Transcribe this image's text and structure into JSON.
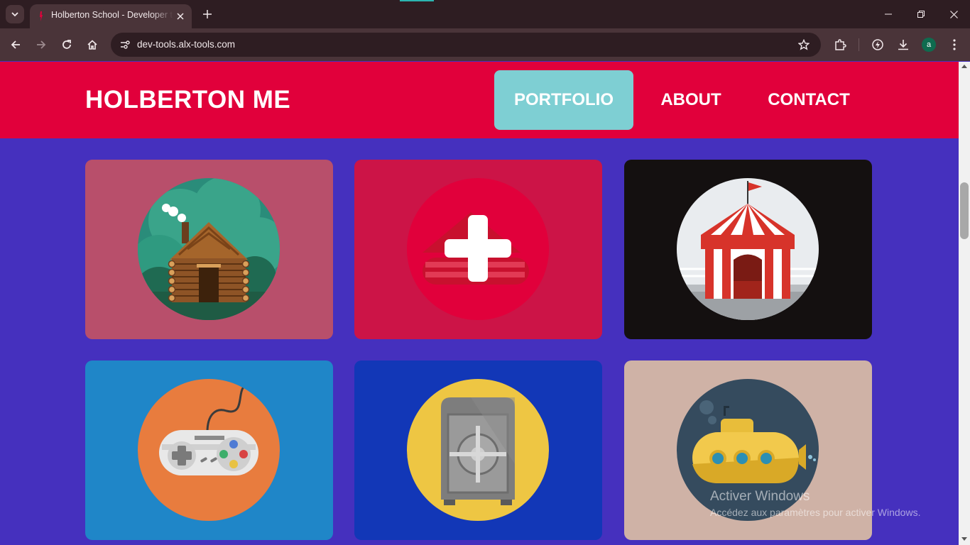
{
  "browser": {
    "tab_title": "Holberton School - Developer tools",
    "url": "dev-tools.alx-tools.com",
    "profile_initial": "a",
    "icons": [
      "tab-search-icon",
      "close-icon",
      "plus-icon",
      "minimize-icon",
      "restore-icon",
      "close-window-icon",
      "back-icon",
      "forward-icon",
      "reload-icon",
      "home-icon",
      "site-info-icon",
      "star-icon",
      "extensions-icon",
      "performance-icon",
      "download-icon",
      "kebab-menu-icon"
    ]
  },
  "site": {
    "brand": "HOLBERTON ME",
    "nav": [
      {
        "label": "PORTFOLIO",
        "active": true
      },
      {
        "label": "ABOUT",
        "active": false
      },
      {
        "label": "CONTACT",
        "active": false
      }
    ],
    "colors": {
      "header": "#e1003b",
      "background": "#4530be",
      "active_nav": "#7ecfd3"
    }
  },
  "portfolio": [
    {
      "name": "log-cabin",
      "bg": "#b84f6b",
      "circle": "#2a8c7a"
    },
    {
      "name": "red-plus",
      "bg": "#cc1447",
      "circle": "#e1003b"
    },
    {
      "name": "circus-tent",
      "bg": "#141010",
      "circle": "#e9ecef"
    },
    {
      "name": "game-controller",
      "bg": "#1f86c8",
      "circle": "#e87c3e"
    },
    {
      "name": "safe",
      "bg": "#1237b7",
      "circle": "#eec643"
    },
    {
      "name": "submarine",
      "bg": "#cfb2a6",
      "circle": "#354b5e"
    }
  ],
  "watermark": {
    "title": "Activer Windows",
    "subtitle": "Accédez aux paramètres pour activer Windows."
  }
}
